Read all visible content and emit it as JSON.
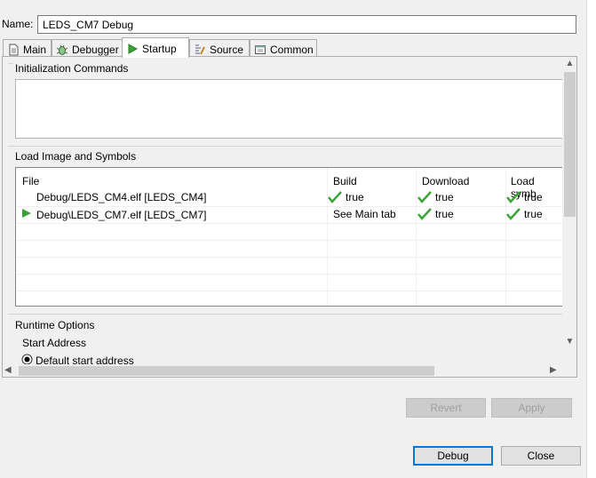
{
  "name_field": {
    "label": "Name:",
    "value": "LEDS_CM7 Debug"
  },
  "tabs": [
    {
      "label": "Main",
      "icon": "document-icon",
      "active": false
    },
    {
      "label": "Debugger",
      "icon": "bug-icon",
      "active": false
    },
    {
      "label": "Startup",
      "icon": "play-icon",
      "active": true
    },
    {
      "label": "Source",
      "icon": "source-icon",
      "active": false
    },
    {
      "label": "Common",
      "icon": "window-icon",
      "active": false
    }
  ],
  "init_commands": {
    "title": "Initialization Commands",
    "value": ""
  },
  "load_image": {
    "title": "Load Image and Symbols",
    "columns": [
      "File",
      "Build",
      "Download",
      "Load symb"
    ],
    "rows": [
      {
        "file": "Debug/LEDS_CM4.elf [LEDS_CM4]",
        "build": "true",
        "download": "true",
        "load_symbols": "true",
        "active": false
      },
      {
        "file": "Debug\\LEDS_CM7.elf [LEDS_CM7]",
        "build": "See Main tab",
        "download": "true",
        "load_symbols": "true",
        "active": true
      }
    ]
  },
  "runtime_options": {
    "title": "Runtime Options",
    "start_address_label": "Start Address",
    "default_start_address": "Default start address"
  },
  "buttons": {
    "revert": "Revert",
    "apply": "Apply",
    "debug": "Debug",
    "close": "Close"
  },
  "colors": {
    "check": "#3aa335",
    "active_arrow": "#3aa335",
    "default_button_border": "#0078d7"
  }
}
